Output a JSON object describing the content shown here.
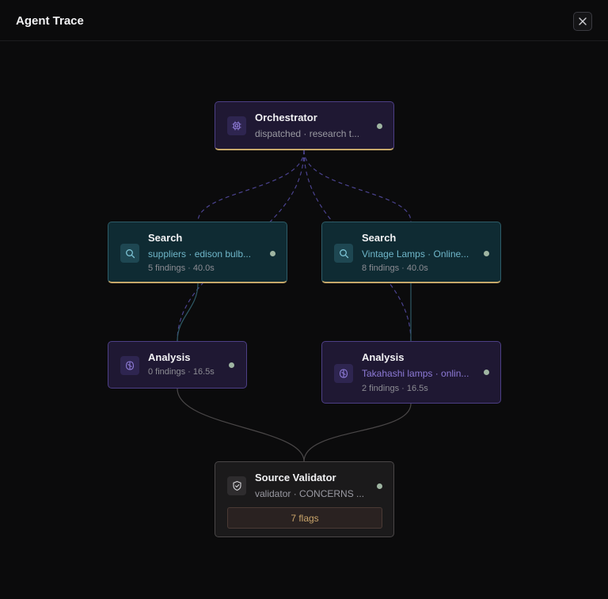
{
  "header": {
    "title": "Agent Trace",
    "close_icon": "close-icon"
  },
  "colors": {
    "accent_gold": "#c6a86a",
    "search_teal": "#6fb6c9",
    "analysis_purple": "#8d7ad6",
    "status_dot": "#9fb5a2"
  },
  "nodes": {
    "orchestrator": {
      "icon": "cpu-icon",
      "title": "Orchestrator",
      "subtitle": "dispatched · research t..."
    },
    "search1": {
      "icon": "search-icon",
      "title": "Search",
      "subtitle": "suppliers · edison bulb...",
      "meta": "5 findings · 40.0s"
    },
    "search2": {
      "icon": "search-icon",
      "title": "Search",
      "subtitle": "Vintage Lamps · Online...",
      "meta": "8 findings · 40.0s"
    },
    "analysis1": {
      "icon": "brain-icon",
      "title": "Analysis",
      "meta": "0 findings · 16.5s"
    },
    "analysis2": {
      "icon": "brain-icon",
      "title": "Analysis",
      "subtitle": "Takahashi lamps · onlin...",
      "meta": "2 findings · 16.5s"
    },
    "validator": {
      "icon": "shield-check-icon",
      "title": "Source Validator",
      "subtitle": "validator · CONCERNS ...",
      "flags": "7 flags"
    }
  }
}
